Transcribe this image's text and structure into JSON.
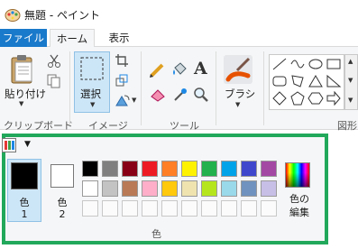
{
  "window": {
    "title": "無題 - ペイント"
  },
  "tabs": {
    "file": "ファイル",
    "home": "ホーム",
    "view": "表示"
  },
  "groups": {
    "clipboard": {
      "label": "クリップボード",
      "paste": "貼り付け"
    },
    "image": {
      "label": "イメージ",
      "select": "選択"
    },
    "tools": {
      "label": "ツール"
    },
    "brushes": {
      "label": "ブラシ"
    },
    "shapes": {
      "label": "図形"
    }
  },
  "colors": {
    "label": "色",
    "color1_label": "色",
    "color1_num": "1",
    "color2_label": "色",
    "color2_num": "2",
    "color1_value": "#000000",
    "color2_value": "#ffffff",
    "edit_line1": "色の",
    "edit_line2": "編集",
    "row1": [
      "#000000",
      "#7f7f7f",
      "#880015",
      "#ed1c24",
      "#ff7f27",
      "#fff200",
      "#22b14c",
      "#00a2e8",
      "#3f48cc",
      "#a349a4"
    ],
    "row2": [
      "#ffffff",
      "#c3c3c3",
      "#b97a57",
      "#ffaec9",
      "#ffc90e",
      "#efe4b0",
      "#b5e61d",
      "#99d9ea",
      "#7092be",
      "#c8bfe7"
    ]
  },
  "accent": {
    "file_tab": "#1979ca",
    "highlight_border": "#22a85a"
  },
  "icons": [
    "paint-app-icon",
    "paste-icon",
    "cut-icon",
    "copy-icon",
    "select-icon",
    "crop-icon",
    "resize-icon",
    "rotate-icon",
    "pencil-icon",
    "fill-icon",
    "text-icon",
    "eraser-icon",
    "color-picker-icon",
    "magnifier-icon",
    "brush-icon",
    "line-shape-icon",
    "curve-shape-icon",
    "oval-shape-icon",
    "rectangle-shape-icon",
    "rounded-rect-shape-icon",
    "polygon-shape-icon",
    "triangle-shape-icon",
    "right-triangle-shape-icon",
    "diamond-shape-icon",
    "pentagon-shape-icon",
    "hexagon-shape-icon",
    "arrow-shape-icon",
    "palette-qat-icon",
    "edit-colors-icon"
  ]
}
